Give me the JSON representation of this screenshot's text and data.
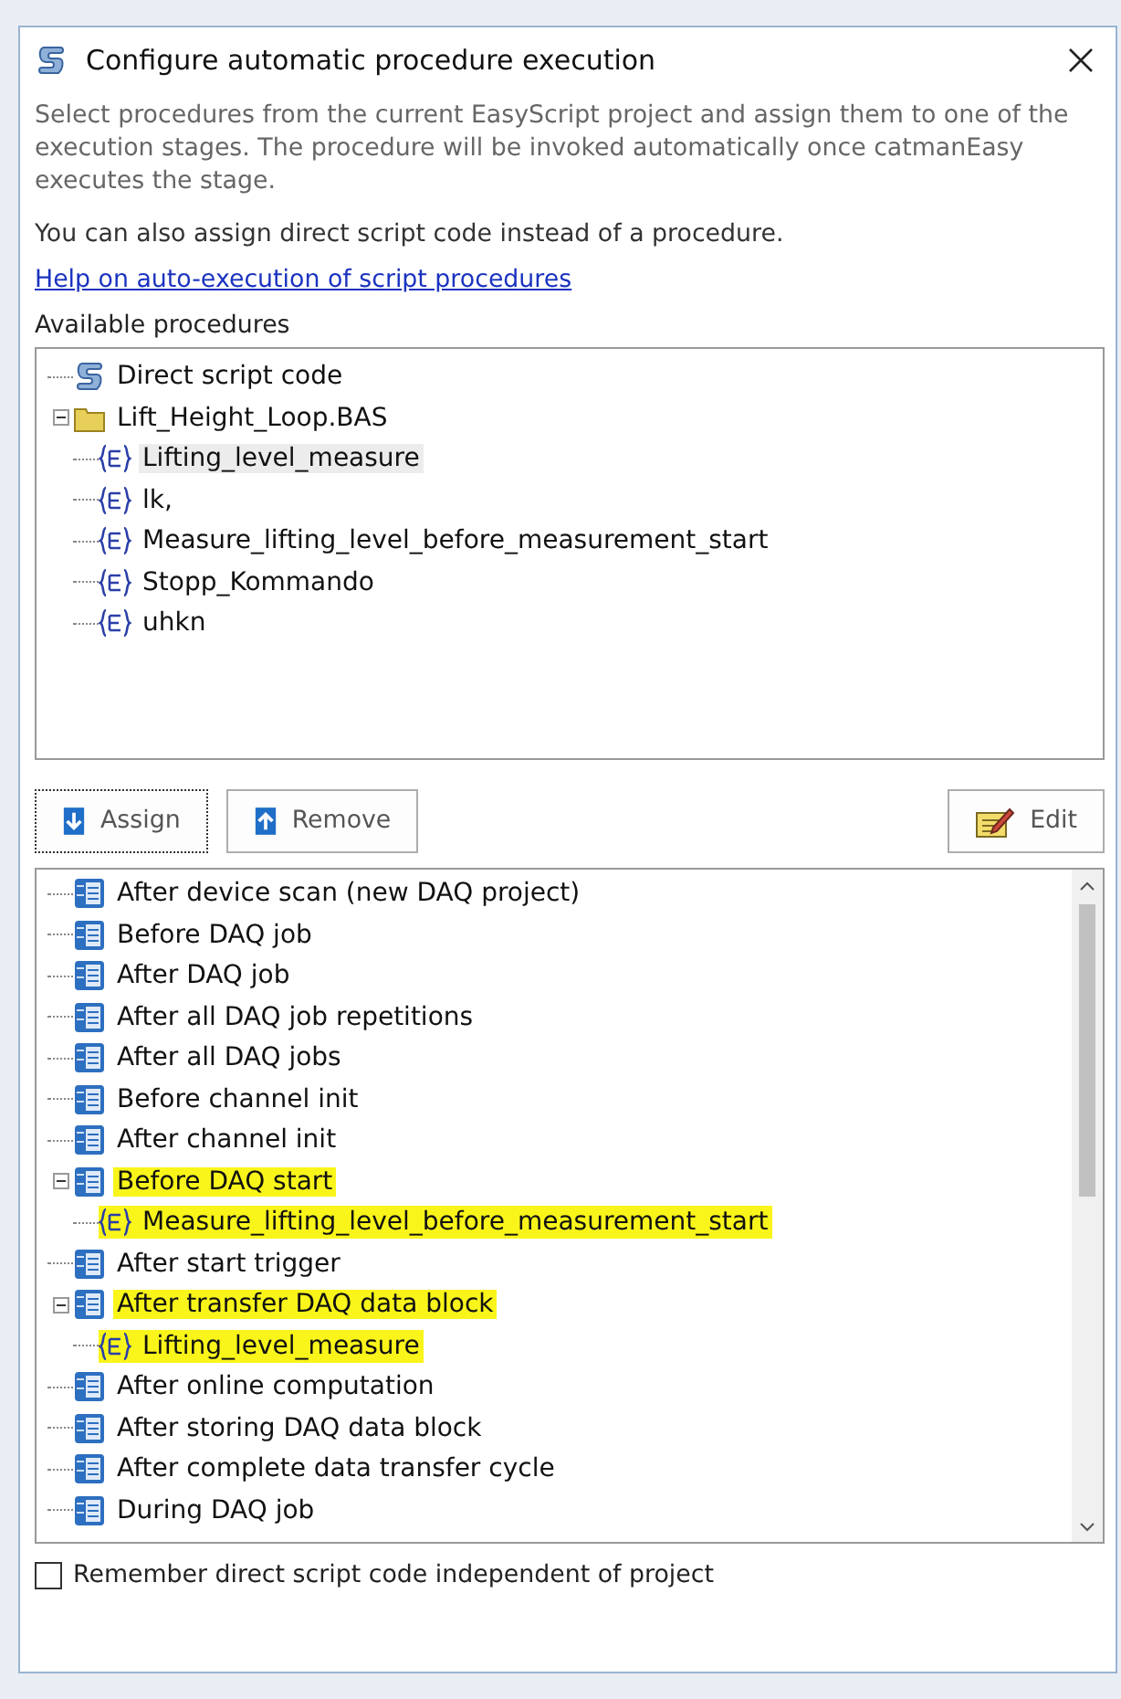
{
  "window": {
    "title": "Configure automatic procedure execution"
  },
  "description": "Select procedures from the current EasyScript project and assign them to one of the execution stages. The procedure will be invoked automatically once catmanEasy executes the stage.",
  "note": "You can also assign direct script code instead of a procedure.",
  "help_link": "Help on auto-execution of script procedures",
  "procedures_label": "Available procedures",
  "procedures": [
    {
      "kind": "direct",
      "label": "Direct script code",
      "selected": false
    },
    {
      "kind": "module",
      "label": "Lift_Height_Loop.BAS",
      "selected": false,
      "expanded": true,
      "children": [
        {
          "kind": "procedure",
          "label": "Lifting_level_measure",
          "selected": true
        },
        {
          "kind": "procedure",
          "label": "lk,",
          "selected": false
        },
        {
          "kind": "procedure",
          "label": "Measure_lifting_level_before_measurement_start",
          "selected": false
        },
        {
          "kind": "procedure",
          "label": "Stopp_Kommando",
          "selected": false
        },
        {
          "kind": "procedure",
          "label": "uhkn",
          "selected": false
        }
      ]
    }
  ],
  "buttons": [
    {
      "kind": "assign",
      "label": "Assign"
    },
    {
      "kind": "remove",
      "label": "Remove"
    },
    {
      "kind": "edit",
      "label": "Edit"
    }
  ],
  "stages": [
    {
      "label": "After device scan (new DAQ project)",
      "highlighted": false
    },
    {
      "label": "Before DAQ job",
      "highlighted": false
    },
    {
      "label": "After DAQ job",
      "highlighted": false
    },
    {
      "label": "After all DAQ job repetitions",
      "highlighted": false
    },
    {
      "label": "After all DAQ jobs",
      "highlighted": false
    },
    {
      "label": "Before channel init",
      "highlighted": false
    },
    {
      "label": "After channel init",
      "highlighted": false
    },
    {
      "label": "Before DAQ start",
      "highlighted": true,
      "expanded": true,
      "children": [
        {
          "label": "Measure_lifting_level_before_measurement_start",
          "highlighted": true
        }
      ]
    },
    {
      "label": "After start trigger",
      "highlighted": false
    },
    {
      "label": "After transfer DAQ data block",
      "highlighted": true,
      "expanded": true,
      "children": [
        {
          "label": "Lifting_level_measure",
          "highlighted": true
        }
      ]
    },
    {
      "label": "After online computation",
      "highlighted": false
    },
    {
      "label": "After storing DAQ data block",
      "highlighted": false
    },
    {
      "label": "After complete data transfer cycle",
      "highlighted": false
    },
    {
      "label": "During DAQ job",
      "highlighted": false
    }
  ],
  "remember": {
    "label": "Remember direct script code independent of project",
    "checked": false
  }
}
